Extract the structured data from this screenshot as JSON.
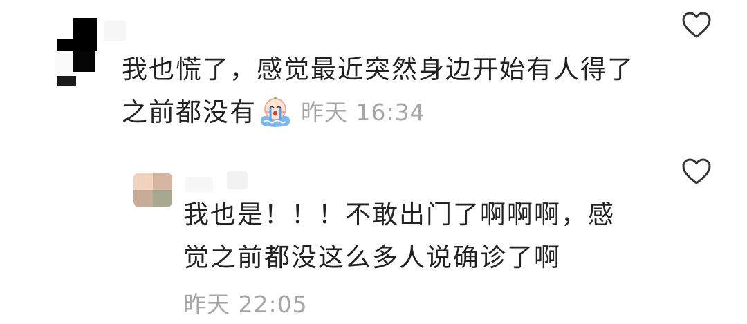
{
  "comment": {
    "text_line1": "我也慌了，感觉最近突然身边开始有人得了",
    "text_line2": "之前都没有",
    "emoji": "crying-emoji",
    "time": "昨天 16:34"
  },
  "reply": {
    "text_line1": "我也是！！！不敢出门了啊啊啊，感",
    "text_line2": "觉之前都没这么多人说确诊了啊",
    "time": "昨天 22:05"
  },
  "icons": {
    "like": "heart-outline-icon"
  },
  "colors": {
    "text": "#222222",
    "meta": "#a6a6a6",
    "icon": "#333333"
  }
}
